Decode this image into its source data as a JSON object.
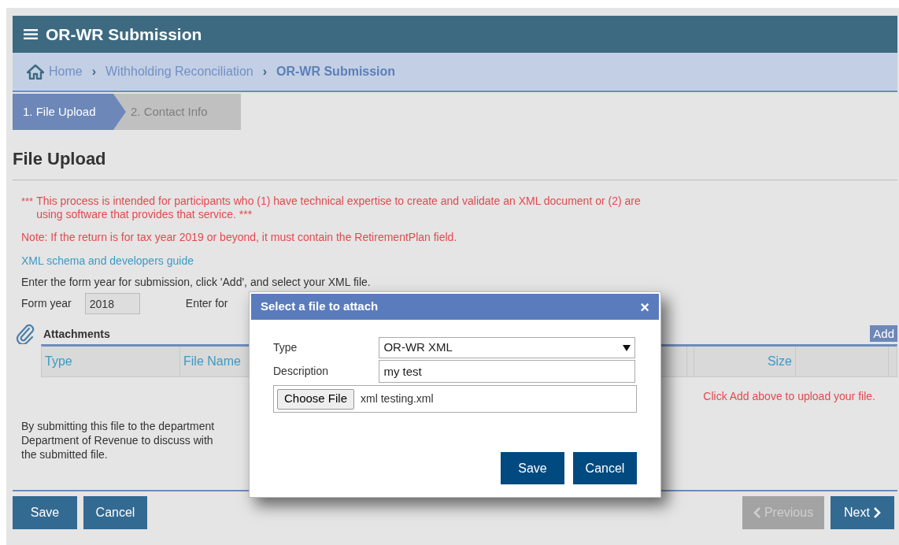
{
  "header": {
    "title": "OR-WR Submission"
  },
  "breadcrumb_separator": "›",
  "breadcrumb": [
    {
      "label": "Home",
      "current": false
    },
    {
      "label": "Withholding Reconciliation",
      "current": false
    },
    {
      "label": "OR-WR Submission",
      "current": true
    }
  ],
  "steps": [
    {
      "label": "1. File Upload",
      "selected": true
    },
    {
      "label": "2. Contact Info",
      "selected": false
    }
  ],
  "page_title": "File Upload",
  "notices": [
    {
      "kind": "warning",
      "stars": "***",
      "text": "This process is intended for participants who (1) have technical expertise to create and validate an XML document or (2) are using software that provides that service. ***"
    },
    {
      "kind": "note",
      "text": "Note: If the return is for tax year 2019 or beyond, it must contain the RetirementPlan field."
    },
    {
      "kind": "link",
      "text": "XML schema and developers guide"
    },
    {
      "kind": "plain",
      "text": "Enter the form year for submission, click 'Add', and select your XML file."
    }
  ],
  "form_year": {
    "label": "Form year",
    "value": "2018",
    "disabled": true
  },
  "enter_label": "Enter for",
  "attachments": {
    "title": "Attachments",
    "add_button": "Add",
    "columns": [
      "Type",
      "File Name",
      "Size"
    ],
    "empty_message": "Click Add above to upload your file."
  },
  "disclaimer_lines": [
    "By submitting this file to the department",
    "Department of Revenue to discuss with",
    "the submitted file."
  ],
  "footer": {
    "left_buttons": [
      {
        "label": "Save",
        "disabled": false
      },
      {
        "label": "Cancel",
        "disabled": false
      }
    ],
    "previous": {
      "label": "Previous",
      "disabled": true
    },
    "next": {
      "label": "Next",
      "disabled": false
    }
  },
  "dialog": {
    "title": "Select a file to attach",
    "close": "×",
    "type_label": "Type",
    "type_value": "OR-WR XML",
    "description_label": "Description",
    "description_value": "my test",
    "choose_button": "Choose File",
    "file_name": "xml testing.xml",
    "buttons": [
      "Save",
      "Cancel"
    ]
  }
}
